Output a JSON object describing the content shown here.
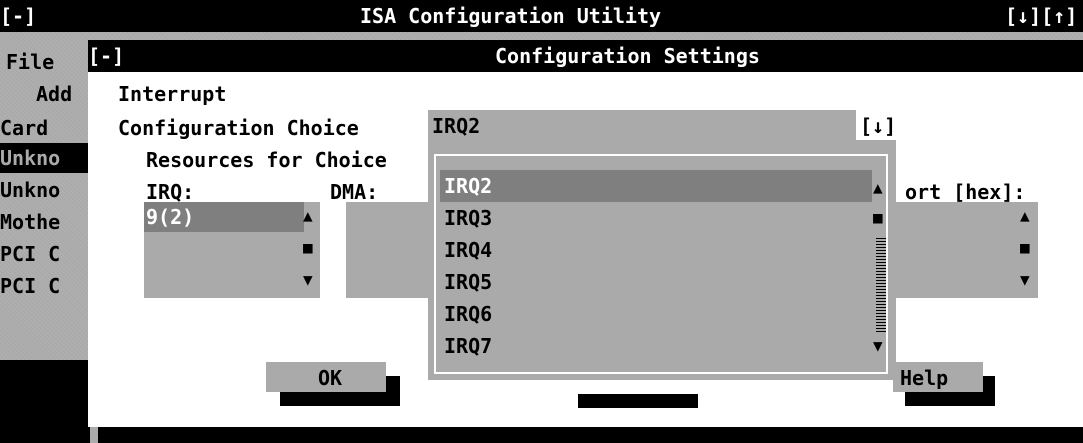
{
  "outer": {
    "close_box": "[-]",
    "title": "ISA Configuration Utility",
    "controls": "[↓][↑]",
    "menu": {
      "file": "File"
    },
    "left_labels": {
      "add": "Add",
      "card": "Card"
    },
    "card_list": [
      "Unkno",
      "Unkno",
      "Mothe",
      "PCI C",
      "PCI C"
    ]
  },
  "dialog": {
    "close_box": "[-]",
    "title": "Configuration Settings",
    "section": "Interrupt",
    "choice_label": "Configuration Choice",
    "choice_value": "IRQ2",
    "choice_arrow": "[↓]",
    "resources_label": "Resources for Choice",
    "irq_label": "IRQ:",
    "dma_label": "DMA:",
    "port_label": "ort [hex]:",
    "irq_list": [
      "9(2)"
    ],
    "ok": "OK",
    "help": "Help"
  },
  "dropdown": {
    "options": [
      "IRQ2",
      "IRQ3",
      "IRQ4",
      "IRQ5",
      "IRQ6",
      "IRQ7"
    ],
    "selected": "IRQ2"
  },
  "scroll_glyphs": {
    "up": "▲",
    "thumb": "■",
    "down": "▼"
  }
}
